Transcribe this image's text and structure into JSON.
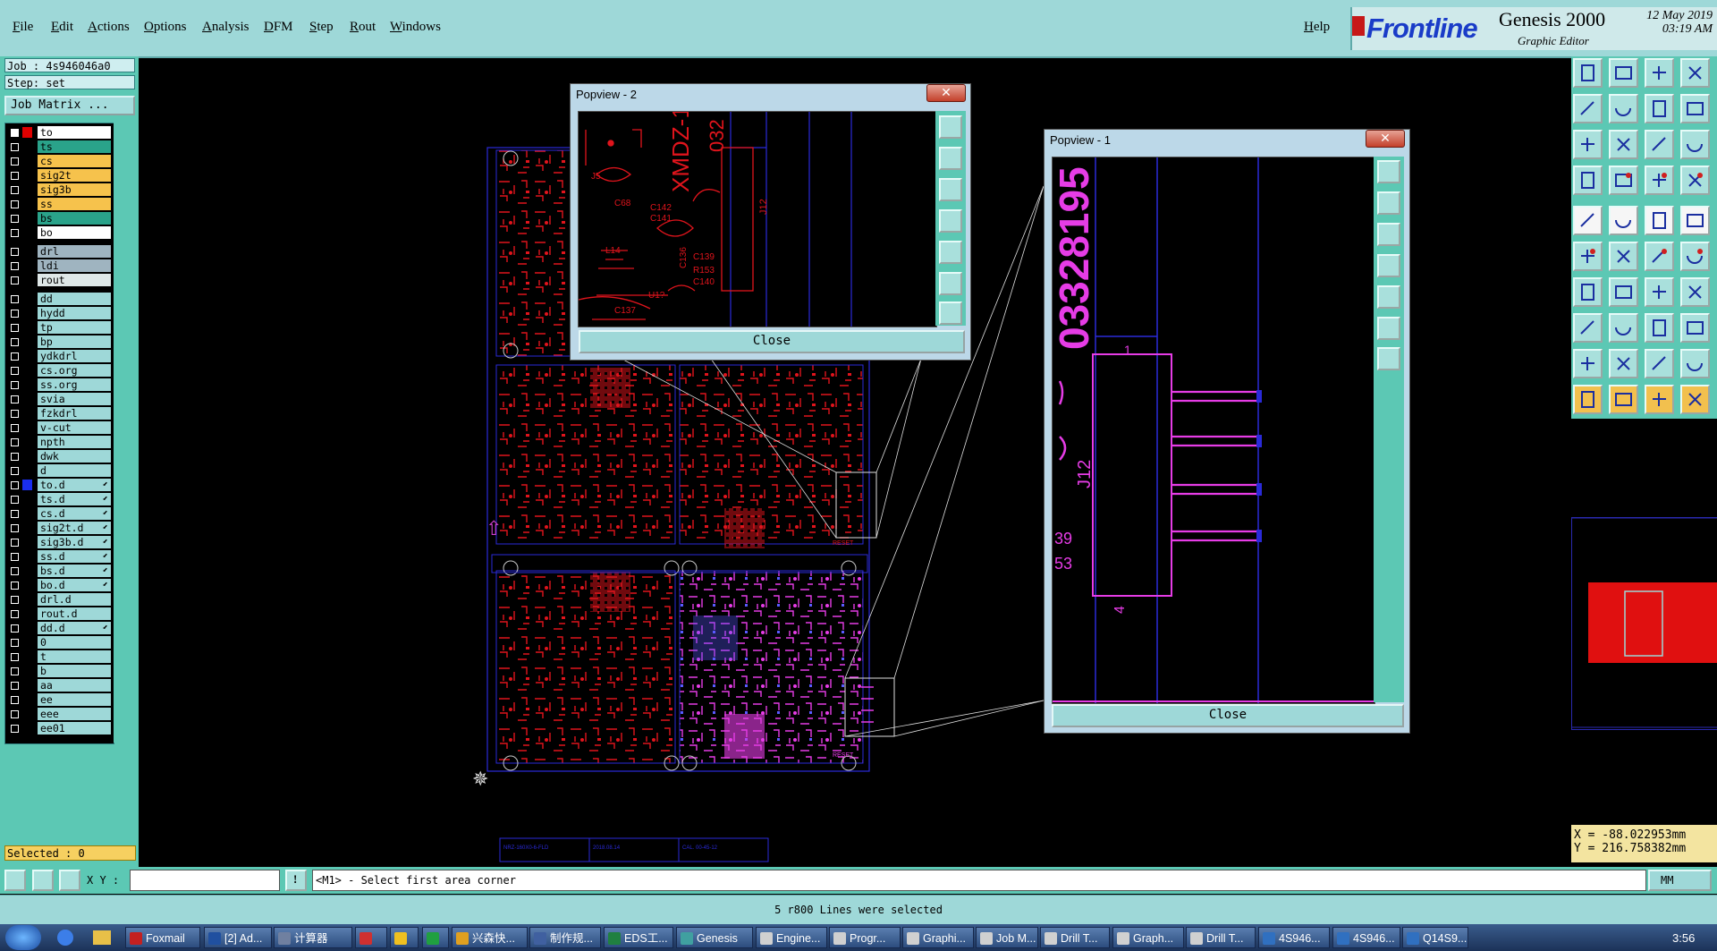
{
  "menu": {
    "items": [
      "File",
      "Edit",
      "Actions",
      "Options",
      "Analysis",
      "DFM",
      "Step",
      "Rout",
      "Windows"
    ],
    "help": "Help"
  },
  "branding": {
    "logo": "Frontline",
    "product": "Genesis 2000",
    "subtitle": "Graphic Editor",
    "date": "12 May 2019",
    "time": "03:19 AM"
  },
  "left_panel": {
    "job": "Job : 4s946046a0",
    "step": "Step: set",
    "job_matrix": "Job Matrix ...",
    "selected": "Selected : 0"
  },
  "layers": [
    {
      "name": "to",
      "color": "#ffffff",
      "swatch": "#e00000",
      "work": true
    },
    {
      "name": "ts",
      "color": "#2aa38a"
    },
    {
      "name": "cs",
      "color": "#f6c24c"
    },
    {
      "name": "sig2t",
      "color": "#f6c24c"
    },
    {
      "name": "sig3b",
      "color": "#f6c24c"
    },
    {
      "name": "ss",
      "color": "#f6c24c"
    },
    {
      "name": "bs",
      "color": "#2aa38a"
    },
    {
      "name": "bo",
      "color": "#ffffff"
    },
    {
      "name": "drl",
      "color": "#9fb4c0",
      "gap": true
    },
    {
      "name": "ldi",
      "color": "#9fb4c0"
    },
    {
      "name": "rout",
      "color": "#dfe8e8"
    },
    {
      "name": "dd",
      "color": "#9ed8d8",
      "gap": true
    },
    {
      "name": "hydd",
      "color": "#9ed8d8"
    },
    {
      "name": "tp",
      "color": "#9ed8d8"
    },
    {
      "name": "bp",
      "color": "#9ed8d8"
    },
    {
      "name": "ydkdrl",
      "color": "#9ed8d8"
    },
    {
      "name": "cs.org",
      "color": "#9ed8d8"
    },
    {
      "name": "ss.org",
      "color": "#9ed8d8"
    },
    {
      "name": "svia",
      "color": "#9ed8d8"
    },
    {
      "name": "fzkdrl",
      "color": "#9ed8d8"
    },
    {
      "name": "v-cut",
      "color": "#9ed8d8"
    },
    {
      "name": "npth",
      "color": "#9ed8d8"
    },
    {
      "name": "dwk",
      "color": "#9ed8d8"
    },
    {
      "name": "d",
      "color": "#9ed8d8"
    },
    {
      "name": "to.d",
      "color": "#9ed8d8",
      "swatch": "#1a2ef0",
      "arrow": true
    },
    {
      "name": "ts.d",
      "color": "#9ed8d8",
      "arrow": true
    },
    {
      "name": "cs.d",
      "color": "#9ed8d8",
      "arrow": true
    },
    {
      "name": "sig2t.d",
      "color": "#9ed8d8",
      "arrow": true
    },
    {
      "name": "sig3b.d",
      "color": "#9ed8d8",
      "arrow": true
    },
    {
      "name": "ss.d",
      "color": "#9ed8d8",
      "arrow": true
    },
    {
      "name": "bs.d",
      "color": "#9ed8d8",
      "arrow": true
    },
    {
      "name": "bo.d",
      "color": "#9ed8d8",
      "arrow": true
    },
    {
      "name": "drl.d",
      "color": "#9ed8d8"
    },
    {
      "name": "rout.d",
      "color": "#9ed8d8"
    },
    {
      "name": "dd.d",
      "color": "#9ed8d8",
      "arrow": true
    },
    {
      "name": "0",
      "color": "#9ed8d8"
    },
    {
      "name": "t",
      "color": "#9ed8d8"
    },
    {
      "name": "b",
      "color": "#9ed8d8"
    },
    {
      "name": "aa",
      "color": "#9ed8d8"
    },
    {
      "name": "ee",
      "color": "#9ed8d8"
    },
    {
      "name": "eee",
      "color": "#9ed8d8"
    },
    {
      "name": "ee01",
      "color": "#9ed8d8"
    }
  ],
  "popview2": {
    "title": "Popview - 2",
    "close": "Close",
    "labels": {
      "xmdz": "XMDZ-1",
      "n032": "032",
      "c68": "C68",
      "c142": "C142",
      "c141": "C141",
      "c139": "C139",
      "r153": "R153",
      "c140": "C140",
      "c136": "C136",
      "l14": "L14",
      "j12": "J12",
      "u1": "U1?",
      "c137": "C137",
      "j5": "J5"
    }
  },
  "popview1": {
    "title": "Popview - 1",
    "close": "Close",
    "big_text": "03328195",
    "j12": "J12",
    "pin1": "1",
    "pin4": "4",
    "frag1": "39",
    "frag2": "53"
  },
  "board": {
    "reset1": "RESET",
    "reset2": "RESET",
    "title_block": [
      "NRZ-160X0-6-FLD",
      "2018.08.14",
      "CAL. 00-45-12"
    ]
  },
  "coords": {
    "x": "X = -88.022953mm",
    "y": "Y = 216.758382mm"
  },
  "command": {
    "xy_label": "X Y :",
    "xy_value": "",
    "prompt": "<M1> - Select first area corner",
    "units": "MM"
  },
  "status": "5 r800 Lines were selected",
  "taskbar": {
    "items": [
      {
        "label": "Foxmail",
        "color": "#c42020"
      },
      {
        "label": "[2] Ad...",
        "color": "#2050a0"
      },
      {
        "label": "计算器",
        "color": "#7080a0"
      },
      {
        "label": "",
        "color": "#d03030"
      },
      {
        "label": "",
        "color": "#f0c020"
      },
      {
        "label": "",
        "color": "#20a040"
      },
      {
        "label": "兴森快...",
        "color": "#e0a020"
      },
      {
        "label": "制作规...",
        "color": "#4060a0"
      },
      {
        "label": "EDS工...",
        "color": "#208040"
      },
      {
        "label": "Genesis",
        "color": "#40a0a0"
      },
      {
        "label": "Engine...",
        "color": "#d0d0d0"
      },
      {
        "label": "Progr...",
        "color": "#d0d0d0"
      },
      {
        "label": "Graphi...",
        "color": "#d0d0d0"
      },
      {
        "label": "Job M...",
        "color": "#d0d0d0"
      },
      {
        "label": "Drill T...",
        "color": "#d0d0d0"
      },
      {
        "label": "Graph...",
        "color": "#d0d0d0"
      },
      {
        "label": "Drill T...",
        "color": "#d0d0d0"
      },
      {
        "label": "4S946...",
        "color": "#3070c0"
      },
      {
        "label": "4S946...",
        "color": "#3070c0"
      },
      {
        "label": "Q14S9...",
        "color": "#3070c0"
      }
    ],
    "clock": "3:56"
  }
}
